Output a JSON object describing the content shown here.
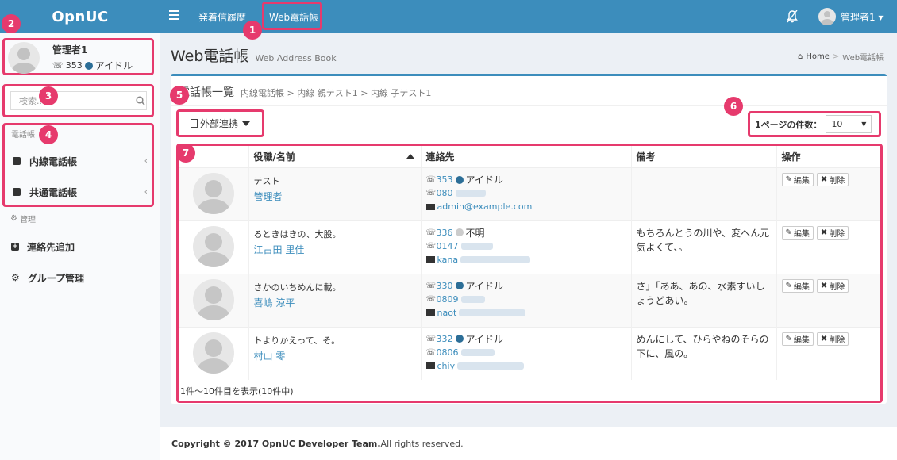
{
  "app": {
    "logo": "OpnUC"
  },
  "topnav": {
    "items": [
      {
        "label": "発着信履歴"
      },
      {
        "label": "Web電話帳"
      }
    ],
    "user": "管理者1 ▾"
  },
  "sidebar": {
    "profile": {
      "name": "管理者1",
      "extension": "353",
      "status": "アイドル"
    },
    "search": {
      "placeholder": "検索..."
    },
    "phonebook_header": "電話帳",
    "phonebook_items": [
      {
        "label": "内線電話帳"
      },
      {
        "label": "共通電話帳"
      }
    ],
    "admin_header": "管理",
    "admin_items": [
      {
        "label": "連絡先追加"
      },
      {
        "label": "グループ管理"
      }
    ]
  },
  "page": {
    "title": "Web電話帳",
    "subtitle": "Web Address Book",
    "breadcrumb": {
      "home": "Home",
      "current": "Web電話帳"
    }
  },
  "box": {
    "title": "電話帳一覧",
    "path": "内線電話帳 > 内線 親テスト1 > 内線 子テスト1",
    "external_button": "外部連携",
    "perpage_label": "1ページの件数：",
    "perpage_value": "10"
  },
  "table": {
    "columns": [
      "役職/名前",
      "連絡先",
      "備考",
      "操作"
    ],
    "rows": [
      {
        "role": "テスト",
        "name": "管理者",
        "ext": "353",
        "status": "アイドル",
        "status_color": "#2c6e97",
        "phone_prefix": "080",
        "email_prefix": "admin@example.com",
        "note": ""
      },
      {
        "role": "るときはきの、大股。",
        "name": "江古田 里佳",
        "ext": "336",
        "status": "不明",
        "status_color": "#cccccc",
        "phone_prefix": "0147",
        "email_prefix": "kana",
        "note": "もちろんとうの川や、変へん元気よくて、。"
      },
      {
        "role": "さかのいちめんに載。",
        "name": "喜嶋 涼平",
        "ext": "330",
        "status": "アイドル",
        "status_color": "#2c6e97",
        "phone_prefix": "0809",
        "email_prefix": "naot",
        "note": "さ」「ああ、あの、水素すいしょうどあい。"
      },
      {
        "role": "トよりかえって、そ。",
        "name": "村山 零",
        "ext": "332",
        "status": "アイドル",
        "status_color": "#2c6e97",
        "phone_prefix": "0806",
        "email_prefix": "chiy",
        "note": "めんにして、ひらやねのそらの下に、風の。"
      }
    ],
    "edit_label": "編集",
    "delete_label": "削除",
    "info": "1件～10件目を表示(10件中)"
  },
  "badges": [
    "1",
    "2",
    "3",
    "4",
    "5",
    "6",
    "7"
  ],
  "footer": {
    "copyright": "Copyright © 2017 OpnUC Developer Team.",
    "rights": " All rights reserved."
  },
  "colors": {
    "brand": "#3c8dbc",
    "highlight": "#e63a6d",
    "idle": "#2c6e97"
  }
}
